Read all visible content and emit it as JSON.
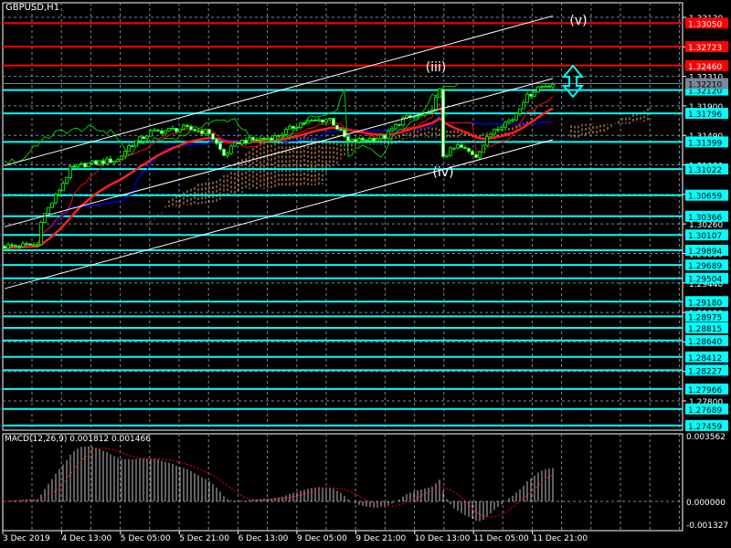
{
  "chart_data": {
    "type": "candlestick",
    "symbol_title": "GBPUSD,H1",
    "price_axis": {
      "range": [
        1.273,
        1.3333
      ],
      "grid_ticks": [
        "1.33130",
        "1.32720",
        "1.32310",
        "1.31900",
        "1.31490",
        "1.31080",
        "1.30670",
        "1.30260",
        "1.29850",
        "1.29440",
        "1.29030",
        "1.28620",
        "1.28210",
        "1.27800"
      ],
      "current_price": "1.32210"
    },
    "time_axis": {
      "labels": [
        "3 Dec 2019",
        "4 Dec 13:00",
        "5 Dec 05:00",
        "5 Dec 21:00",
        "6 Dec 13:00",
        "9 Dec 05:00",
        "9 Dec 21:00",
        "10 Dec 13:00",
        "11 Dec 05:00",
        "11 Dec 21:00"
      ],
      "bars_between_labels": 16
    },
    "close_waypoints": [
      [
        0,
        1.2995
      ],
      [
        9,
        1.2997
      ],
      [
        10,
        1.3032
      ],
      [
        14,
        1.3064
      ],
      [
        18,
        1.3102
      ],
      [
        22,
        1.3109
      ],
      [
        31,
        1.3115
      ],
      [
        34,
        1.3134
      ],
      [
        40,
        1.3153
      ],
      [
        49,
        1.3159
      ],
      [
        56,
        1.3153
      ],
      [
        60,
        1.3121
      ],
      [
        64,
        1.314
      ],
      [
        74,
        1.3147
      ],
      [
        81,
        1.3166
      ],
      [
        89,
        1.3172
      ],
      [
        94,
        1.314
      ],
      [
        104,
        1.3147
      ],
      [
        109,
        1.3172
      ],
      [
        116,
        1.3178
      ],
      [
        119,
        1.321
      ],
      [
        120,
        1.3121
      ],
      [
        124,
        1.3134
      ],
      [
        129,
        1.3121
      ],
      [
        134,
        1.3159
      ],
      [
        139,
        1.3172
      ],
      [
        142,
        1.3198
      ],
      [
        146,
        1.3216
      ],
      [
        150,
        1.3221
      ]
    ],
    "resistance_levels": [
      {
        "price": "1.33050",
        "color": "#ff0000"
      },
      {
        "price": "1.32723",
        "color": "#ff0000"
      },
      {
        "price": "1.32460",
        "color": "#ff0000"
      }
    ],
    "support_levels": [
      "1.32120",
      "1.31796",
      "1.31399",
      "1.31022",
      "1.30659",
      "1.30366",
      "1.30107",
      "1.29894",
      "1.29689",
      "1.29504",
      "1.29180",
      "1.28975",
      "1.28815",
      "1.28640",
      "1.28412",
      "1.28227",
      "1.27966",
      "1.27689",
      "1.27459"
    ],
    "channel_lines": [
      {
        "from": [
          0,
          1.3107
        ],
        "to": [
          150,
          1.3315
        ]
      },
      {
        "from": [
          0,
          1.3022
        ],
        "to": [
          150,
          1.3228
        ]
      },
      {
        "from": [
          0,
          1.2936
        ],
        "to": [
          150,
          1.3143
        ]
      }
    ],
    "wave_labels": [
      {
        "text": "(iii)",
        "bar": 118,
        "price": 1.3238
      },
      {
        "text": "(iv)",
        "bar": 120,
        "price": 1.3092
      },
      {
        "text": "(v)",
        "bar": 157,
        "price": 1.3303
      }
    ],
    "macd": {
      "title": "MACD(12,26,9) 0.001812 0.001466",
      "axis_labels": [
        "0.003562",
        "0.000000",
        "-0.001327"
      ],
      "range": [
        -0.001327,
        0.003562
      ]
    },
    "colors": {
      "candle": "#00ff00",
      "cyan": "#00ffff",
      "red": "#ff0000",
      "cloud": "#f4a460",
      "tenkan": "#ff0000",
      "kijun": "#0000ff",
      "chikou": "#00c800",
      "grid": "#778899"
    }
  }
}
